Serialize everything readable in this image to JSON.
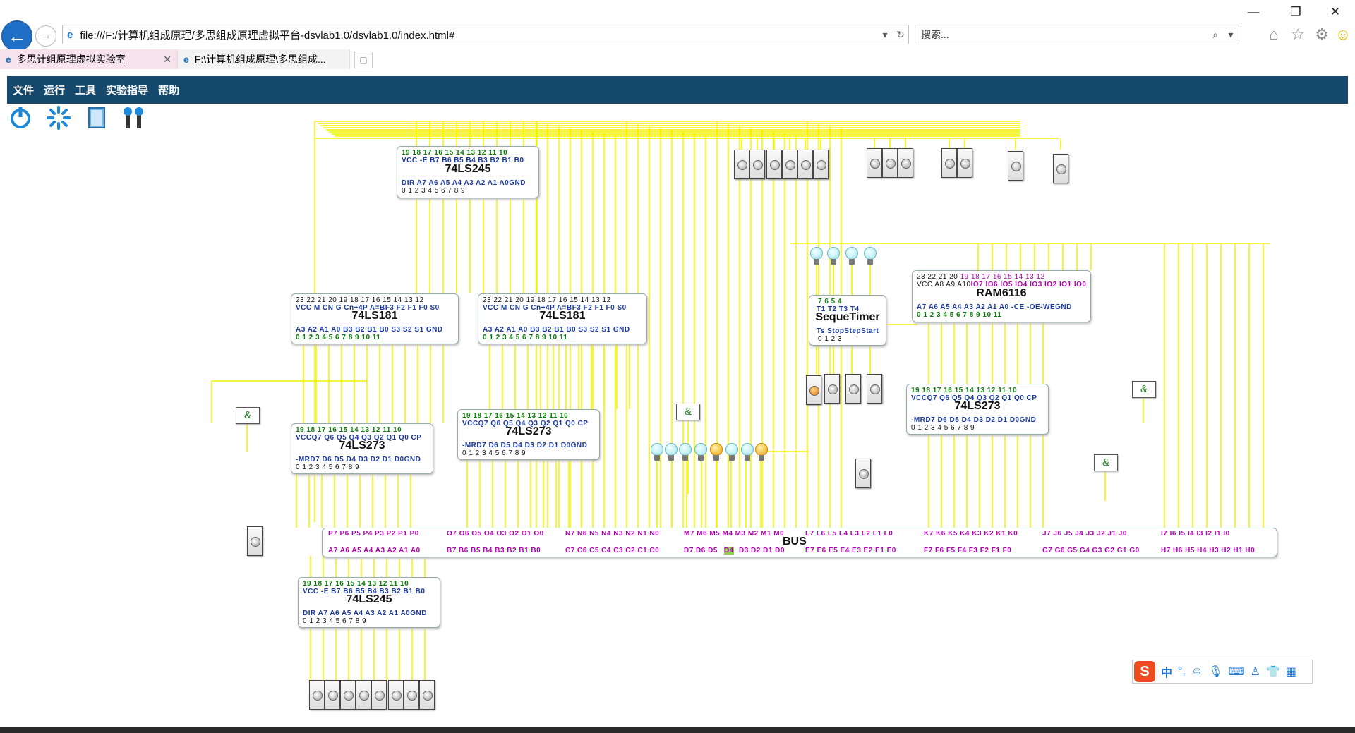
{
  "browser": {
    "address": "file:///F:/计算机组成原理/多思组成原理虚拟平台-dsvlab1.0/dsvlab1.0/index.html#",
    "search_placeholder": "搜索...",
    "tabs": [
      {
        "label": "多思计组原理虚拟实验室",
        "active": true
      },
      {
        "label": "F:\\计算机组成原理\\多思组成...",
        "active": false
      }
    ],
    "window_controls": [
      "—",
      "❐",
      "✕"
    ]
  },
  "menu": [
    "文件",
    "运行",
    "工具",
    "实验指导",
    "帮助"
  ],
  "toolbar_icons": [
    "power-icon",
    "gear-icon",
    "document-icon",
    "tools-icon"
  ],
  "chips": {
    "ls245_top": {
      "pins_top": "19 18 17 16 15 14 13 12 11 10",
      "names_top": "VCC -E  B7 B6 B5 B4 B3 B2 B1 B0",
      "title": "74LS245",
      "names_bot": "DIR A7 A6 A5 A4 A3 A2 A1 A0GND",
      "pins_bot": "0   1   2   3   4   5   6   7   8   9"
    },
    "ls181_left": {
      "pins_top": "23  22  21  20  19  18  17  16  15  14  13  12",
      "names_top": "VCC M  CN  G Cn+4P A=BF3 F2  F1  F0  S0",
      "title": "74LS181",
      "names_bot": "A3  A2  A1  A0  B3  B2  B1  B0  S3  S2  S1 GND",
      "pins_bot": "0   1   2   3   4   5   6   7   8   9  10  11"
    },
    "ls181_right": {
      "pins_top": "23  22  21  20  19  18  17  16  15  14  13  12",
      "names_top": "VCC M  CN  G Cn+4P A=BF3 F2  F1  F0  S0",
      "title": "74LS181",
      "names_bot": "A3  A2  A1  A0  B3  B2  B1  B0  S3  S2  S1 GND",
      "pins_bot": "0   1   2   3   4   5   6   7   8   9  10  11"
    },
    "ls273_left": {
      "pins_top": "19 18 17 16 15 14 13 12 11 10",
      "names_top": "VCCQ7 Q6 Q5 Q4 Q3 Q2 Q1 Q0 CP",
      "title": "74LS273",
      "names_bot": "-MRD7 D6 D5 D4 D3 D2 D1 D0GND",
      "pins_bot": "0   1   2   3   4   5   6   7   8   9"
    },
    "ls273_mid": {
      "pins_top": "19 18 17 16 15 14 13 12 11 10",
      "names_top": "VCCQ7 Q6 Q5 Q4 Q3 Q2 Q1 Q0 CP",
      "title": "74LS273",
      "names_bot": "-MRD7 D6 D5 D4 D3 D2 D1 D0GND",
      "pins_bot": "0   1   2   3   4   5   6   7   8   9"
    },
    "ls273_right": {
      "pins_top": "19 18 17 16 15 14 13 12 11 10",
      "names_top": "VCCQ7 Q6 Q5 Q4 Q3 Q2 Q1 Q0 CP",
      "title": "74LS273",
      "names_bot": "-MRD7 D6 D5 D4 D3 D2 D1 D0GND",
      "pins_bot": "0   1   2   3   4   5   6   7   8   9"
    },
    "seq_timer": {
      "pins_top": "7    6    5    4",
      "names_top": "T1   T2   T3   T4",
      "title": "SequeTimer",
      "names_bot": "Ts  StopStepStart",
      "pins_bot": "0    1    2    3"
    },
    "ram6116": {
      "pins_top_a": "23  22  21  20",
      "pins_top_b": "19  18  17  16  15  14  13  12",
      "names_top_a": "VCC A8  A9 A10",
      "names_top_b": "IO7 IO6 IO5 IO4 IO3 IO2 IO1 IO0",
      "title": "RAM6116",
      "names_bot": "A7  A6  A5  A4  A3  A2  A1  A0  -CE -OE-WEGND",
      "pins_bot": "0   1   2   3   4   5   6   7   8   9  10  11"
    },
    "ls245_bottom": {
      "pins_top": "19 18 17 16 15 14 13 12 11 10",
      "names_top": "VCC -E  B7 B6 B5 B4 B3 B2 B1 B0",
      "title": "74LS245",
      "names_bot": "DIR A7 A6 A5 A4 A3 A2 A1 A0GND",
      "pins_bot": "0   1   2   3   4   5   6   7   8   9"
    }
  },
  "gate_label": "&",
  "bus": {
    "label": "BUS",
    "top_groups": [
      "P7  P6  P5  P4  P3  P2  P1  P0",
      "O7  O6  O5  O4  O3  O2  O1  O0",
      "N7  N6  N5  N4  N3  N2  N1  N0",
      "M7 M6 M5 M4 M3 M2 M1 M0",
      "L7  L6  L5  L4  L3  L2  L1  L0",
      "K7  K6  K5  K4  K3  K2  K1  K0",
      "J7  J6  J5  J4  J3  J2  J1  J0",
      "I7  I6  I5  I4  I3  I2  I1  I0"
    ],
    "bottom_groups": [
      "A7  A6  A5  A4  A3  A2  A1  A0",
      "B7  B6  B5  B4  B3  B2  B1  B0",
      "C7  C6  C5  C4  C3  C2  C1  C0",
      "D7  D6  D5",
      "D4",
      "D3  D2  D1  D0",
      "E7  E6  E5  E4  E3  E2  E1  E0",
      "F7  F6  F5  F4  F3  F2  F1  F0",
      "G7  G6  G5  G4  G3  G2  G1  G0",
      "H7  H6  H5  H4  H3  H2  H1  H0"
    ]
  },
  "bulbs_lit": [
    false,
    false,
    false,
    false,
    true,
    false,
    false,
    true
  ],
  "ime": {
    "logo": "S",
    "lang": "中"
  }
}
